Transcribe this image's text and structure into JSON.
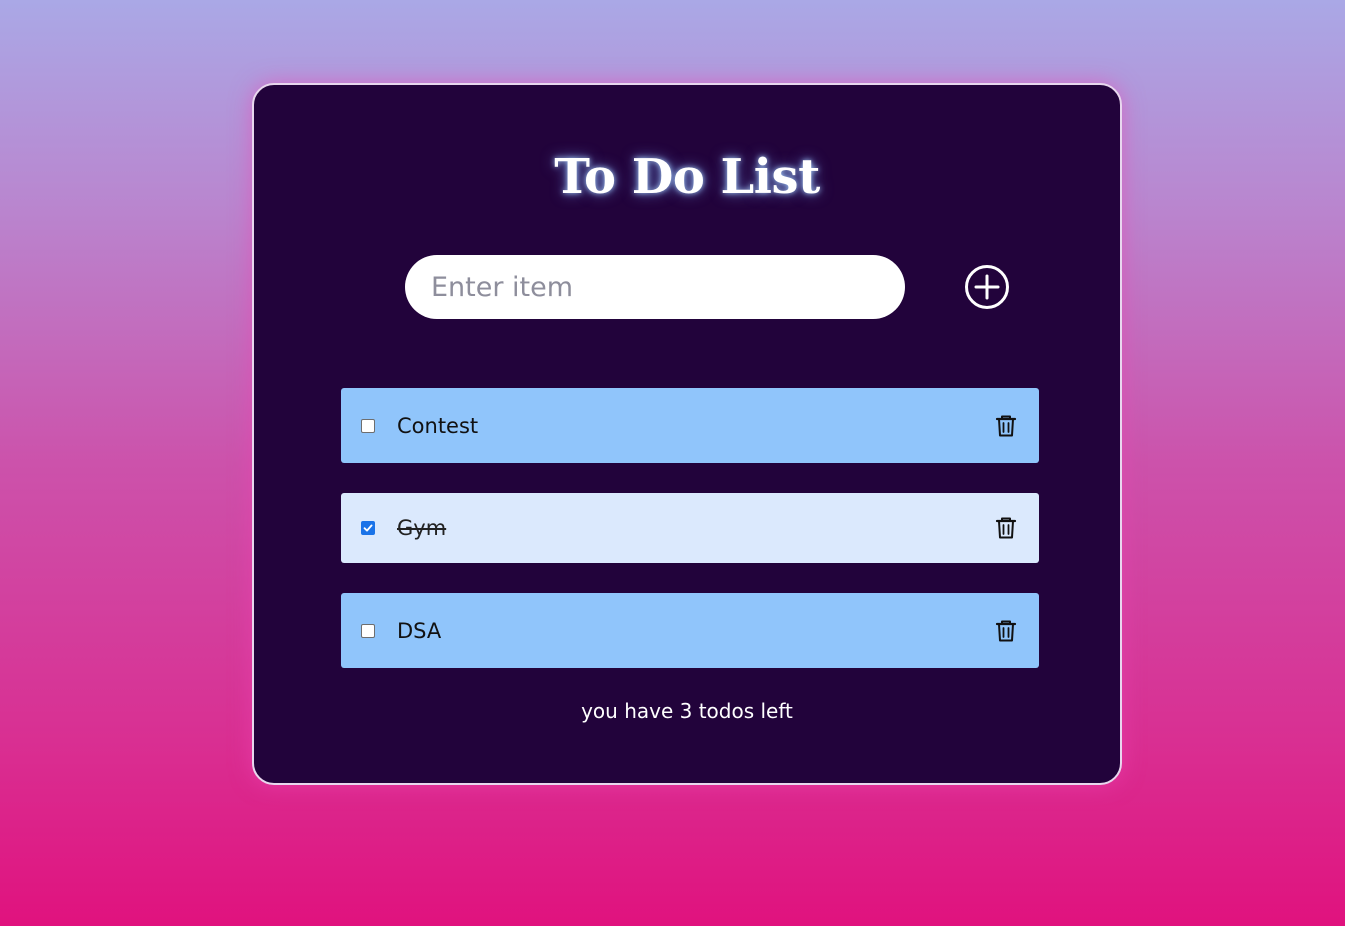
{
  "title": "To Do List",
  "input": {
    "placeholder": "Enter item",
    "value": ""
  },
  "add_button": {
    "icon": "plus-circle-icon"
  },
  "todos": [
    {
      "label": "Contest",
      "completed": false,
      "icon": "trash-icon"
    },
    {
      "label": "Gym",
      "completed": true,
      "icon": "trash-icon"
    },
    {
      "label": "DSA",
      "completed": false,
      "icon": "trash-icon"
    }
  ],
  "footer": "you have 3 todos left",
  "colors": {
    "card_background": "#22033b",
    "item_background": "#90c5fb",
    "item_done_background": "#dbe9fd",
    "checkbox_checked": "#1a73e8",
    "gradient_top": "#aaa8e6",
    "gradient_bottom": "#e0127e"
  }
}
